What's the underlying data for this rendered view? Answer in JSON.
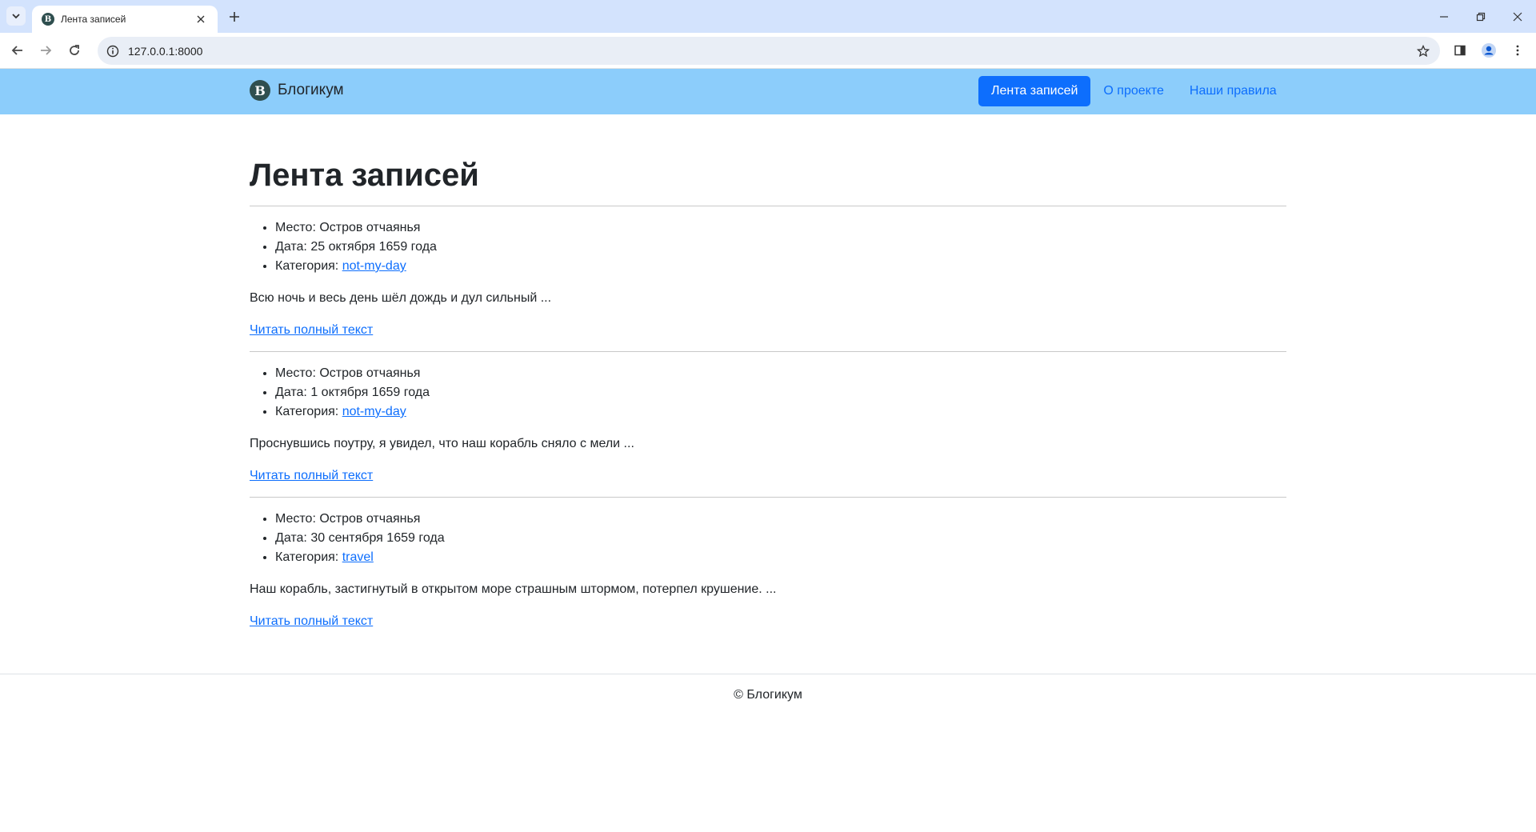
{
  "browser": {
    "tab_title": "Лента записей",
    "favicon_letter": "B",
    "url": "127.0.0.1:8000"
  },
  "navbar": {
    "brand_letter": "B",
    "brand_name": "Блогикум",
    "links": [
      {
        "label": "Лента записей",
        "active": true
      },
      {
        "label": "О проекте",
        "active": false
      },
      {
        "label": "Наши правила",
        "active": false
      }
    ]
  },
  "page": {
    "title": "Лента записей",
    "place_label": "Место: ",
    "date_label": "Дата: ",
    "category_label": "Категория: ",
    "read_more_label": "Читать полный текст",
    "posts": [
      {
        "place": "Остров отчаянья",
        "date": "25 октября 1659 года",
        "category": "not-my-day",
        "excerpt": "Всю ночь и весь день шёл дождь и дул сильный ..."
      },
      {
        "place": "Остров отчаянья",
        "date": "1 октября 1659 года",
        "category": "not-my-day",
        "excerpt": "Проснувшись поутру, я увидел, что наш корабль сняло с мели ..."
      },
      {
        "place": "Остров отчаянья",
        "date": "30 сентября 1659 года",
        "category": "travel",
        "excerpt": "Наш корабль, застигнутый в открытом море страшным штормом, потерпел крушение. ..."
      }
    ]
  },
  "footer": {
    "text": "© Блогикум"
  },
  "colors": {
    "navbar_bg": "#8ccdfb",
    "primary": "#0d6efd",
    "tabstrip_bg": "#d3e3fd"
  }
}
